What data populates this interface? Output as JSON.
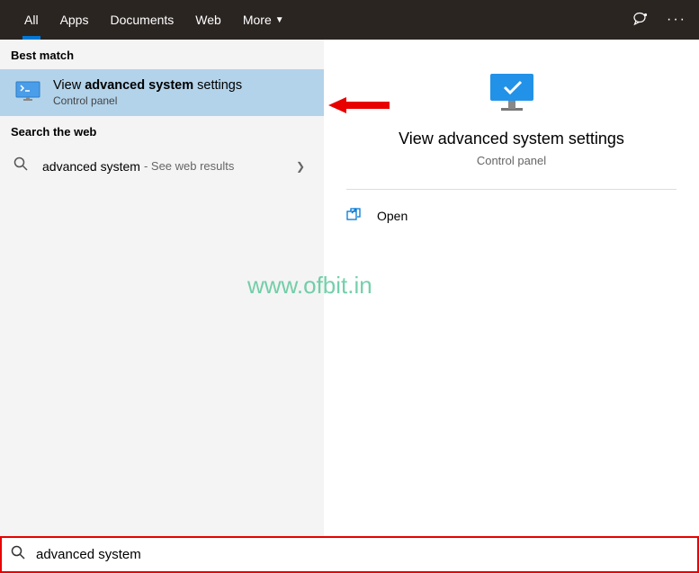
{
  "tabs": [
    "All",
    "Apps",
    "Documents",
    "Web",
    "More"
  ],
  "section_best": "Best match",
  "best": {
    "title_prefix": "View ",
    "title_bold": "advanced system",
    "title_suffix": " settings",
    "sub": "Control panel"
  },
  "section_web": "Search the web",
  "web": {
    "text": "advanced system",
    "suffix": "- See web results"
  },
  "preview": {
    "title": "View advanced system settings",
    "sub": "Control panel"
  },
  "action_open": "Open",
  "watermark": "www.ofbit.in",
  "search_value": "advanced system"
}
